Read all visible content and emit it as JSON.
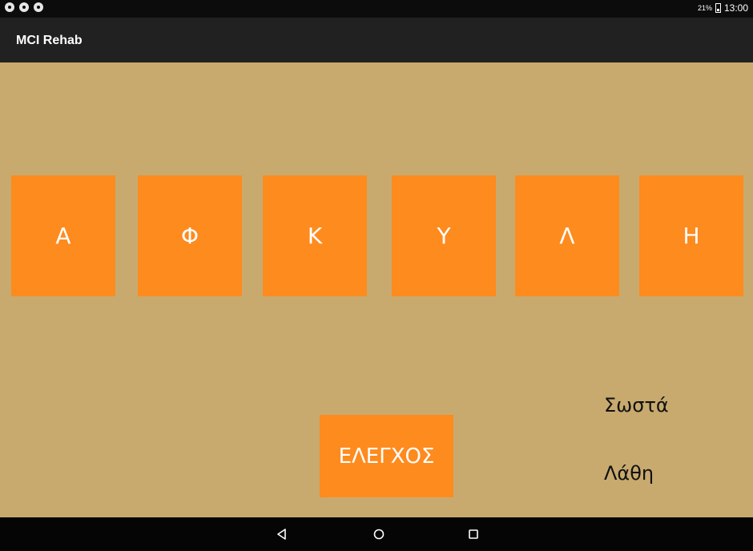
{
  "status_bar": {
    "notification_icons": [
      "notification-icon",
      "notification-icon",
      "notification-icon"
    ],
    "battery_percent": "21%",
    "time": "13:00"
  },
  "app_bar": {
    "title": "MCI Rehab"
  },
  "letters": [
    "Α",
    "Φ",
    "Κ",
    "Υ",
    "Λ",
    "Η"
  ],
  "check_button_label": "ΕΛΕΓΧΟΣ",
  "results": {
    "correct_label": "Σωστά",
    "wrong_label": "Λάθη"
  },
  "nav_bar": {
    "buttons": [
      "back-icon",
      "home-icon",
      "recents-icon"
    ]
  },
  "colors": {
    "background": "#c8aa6e",
    "tile": "#fe8b1e",
    "app_bar": "#212121"
  }
}
